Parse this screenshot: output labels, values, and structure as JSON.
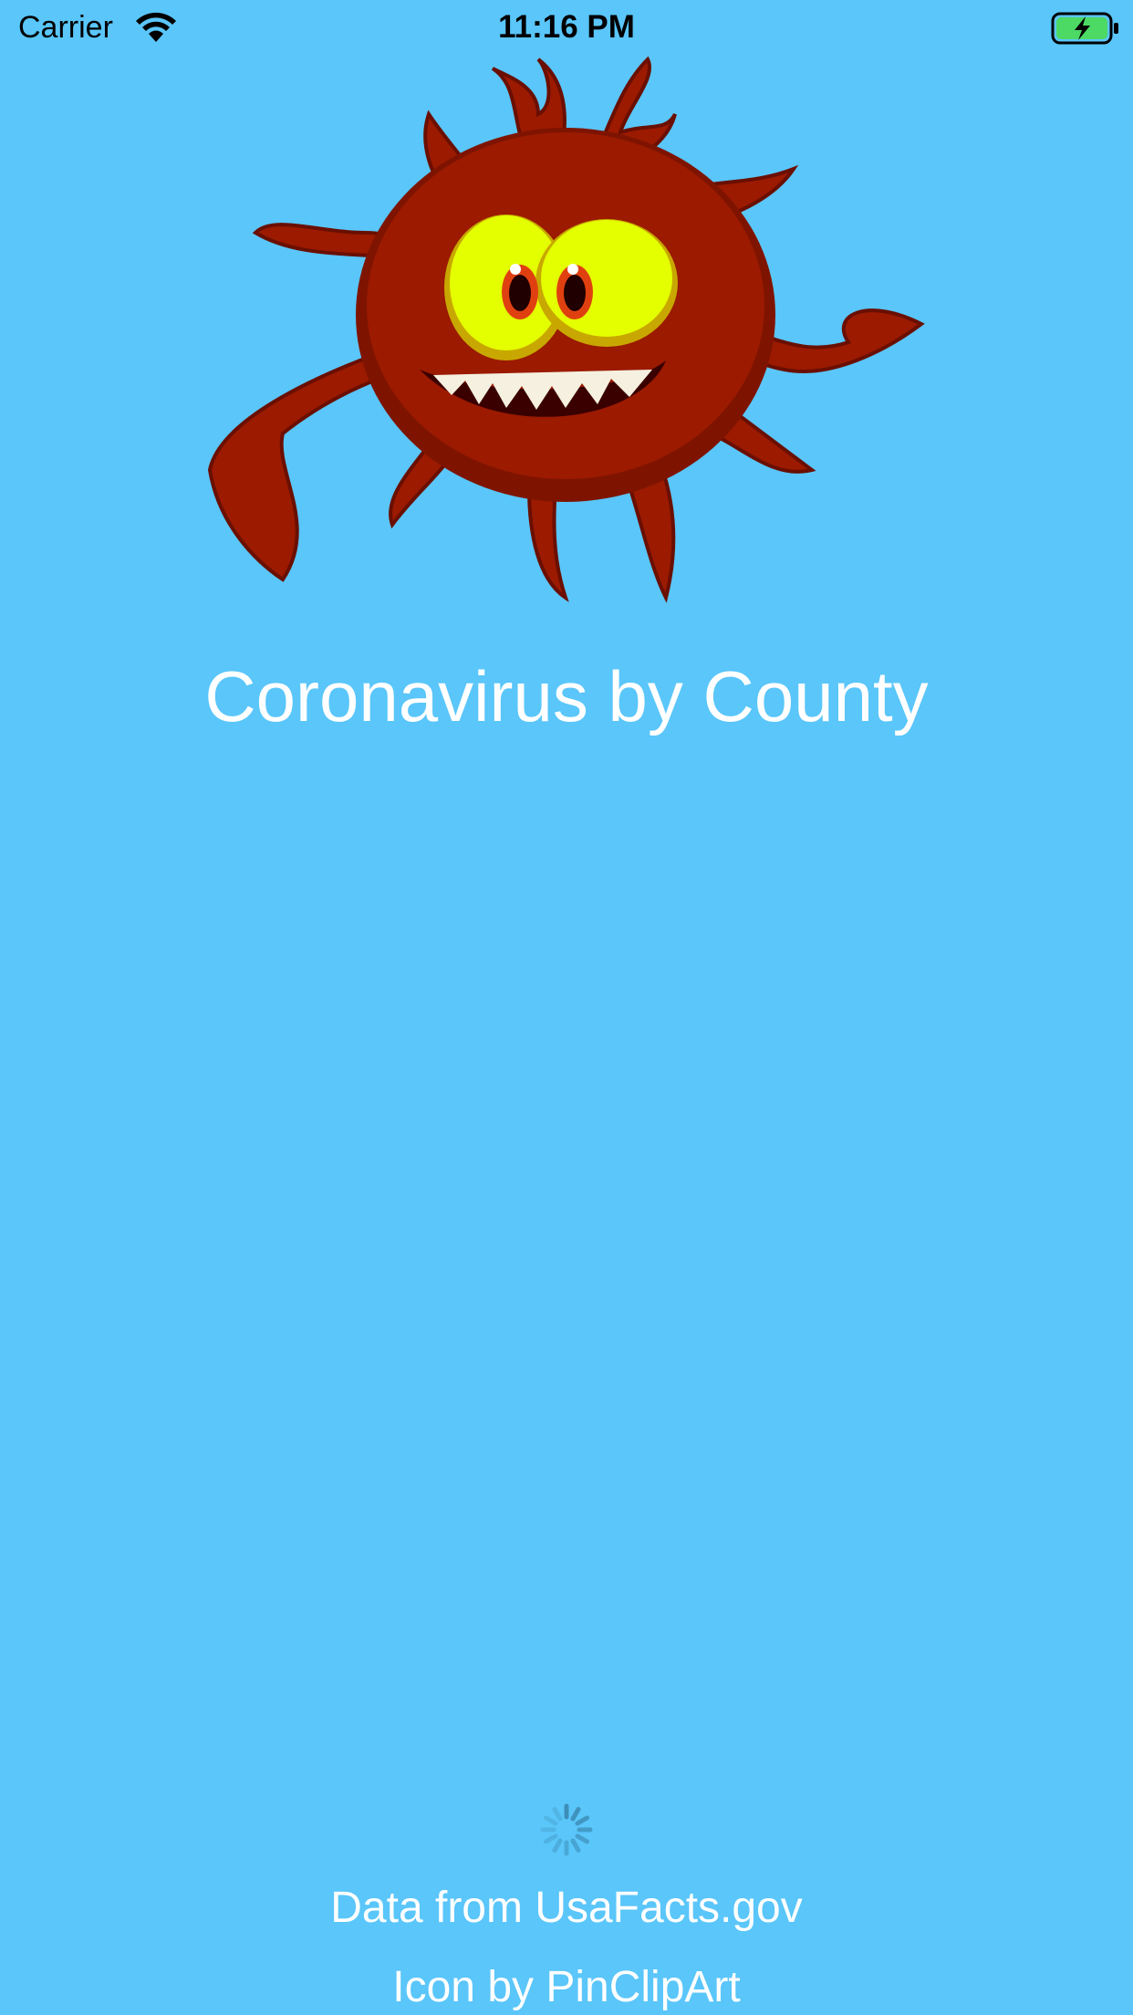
{
  "status_bar": {
    "carrier": "Carrier",
    "time": "11:16 PM"
  },
  "app": {
    "title": "Coronavirus by County"
  },
  "credits": {
    "data": "Data from UsaFacts.gov",
    "icon": "Icon by PinClipArt"
  },
  "colors": {
    "background": "#5ac6fa",
    "virus_body": "#9b1a00",
    "virus_eye": "#e4ff00",
    "battery_fill": "#4cd964"
  },
  "icons": [
    "wifi-icon",
    "battery-charging-icon",
    "virus-illustration",
    "loading-spinner-icon"
  ]
}
